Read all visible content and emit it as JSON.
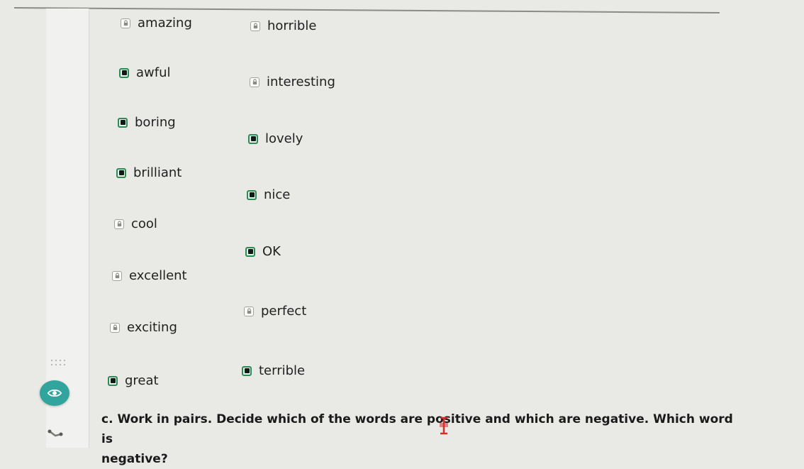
{
  "words_left": [
    {
      "label": "amazing",
      "state": "locked"
    },
    {
      "label": "awful",
      "state": "checked"
    },
    {
      "label": "boring",
      "state": "checked"
    },
    {
      "label": "brilliant",
      "state": "checked"
    },
    {
      "label": "cool",
      "state": "locked"
    },
    {
      "label": "excellent",
      "state": "locked"
    },
    {
      "label": "exciting",
      "state": "locked"
    },
    {
      "label": "great",
      "state": "checked"
    }
  ],
  "words_right": [
    {
      "label": "horrible",
      "state": "locked"
    },
    {
      "label": "interesting",
      "state": "locked"
    },
    {
      "label": "lovely",
      "state": "checked"
    },
    {
      "label": "nice",
      "state": "checked"
    },
    {
      "label": "OK",
      "state": "checked"
    },
    {
      "label": "perfect",
      "state": "locked"
    },
    {
      "label": "terrible",
      "state": "checked"
    }
  ],
  "instruction": {
    "line1": "c. Work in pairs. Decide which of the words are positive and which are negative. Which word is",
    "line2": "negative?"
  },
  "icons": {
    "locked": "lock-icon",
    "checked": "filled-checkbox-icon",
    "eye": "eye-icon",
    "pen": "pen-icon",
    "cursor": "text-cursor-icon"
  },
  "colors": {
    "checkbox_border": "#2e8b57",
    "eye_button": "#31a49d",
    "cursor": "#d1302b"
  }
}
